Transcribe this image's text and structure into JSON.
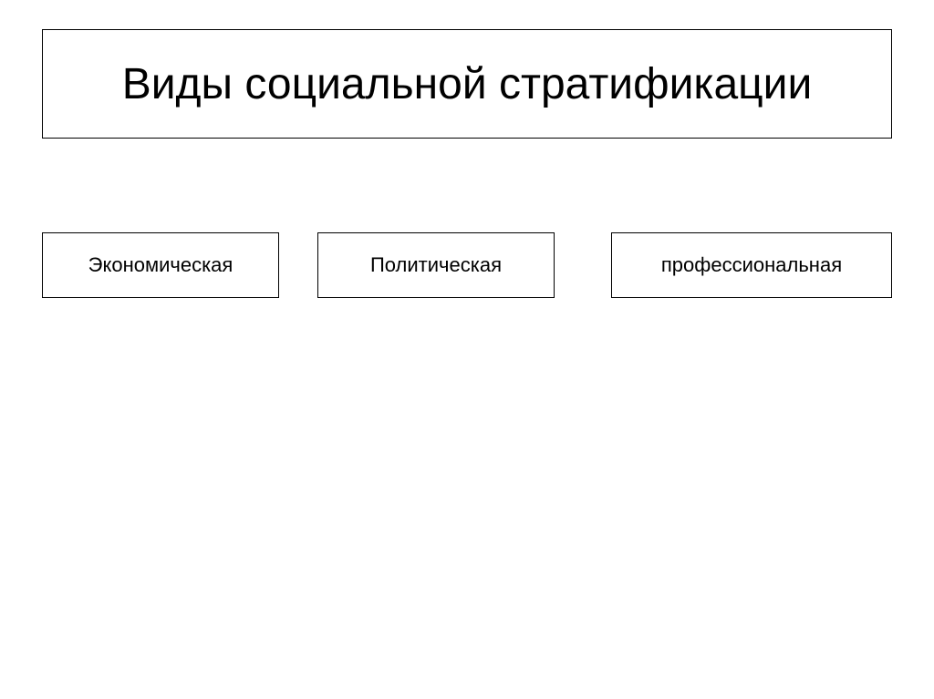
{
  "title": "Виды социальной стратификации",
  "items": [
    {
      "label": "Экономическая"
    },
    {
      "label": "Политическая"
    },
    {
      "label": "профессиональная"
    }
  ]
}
